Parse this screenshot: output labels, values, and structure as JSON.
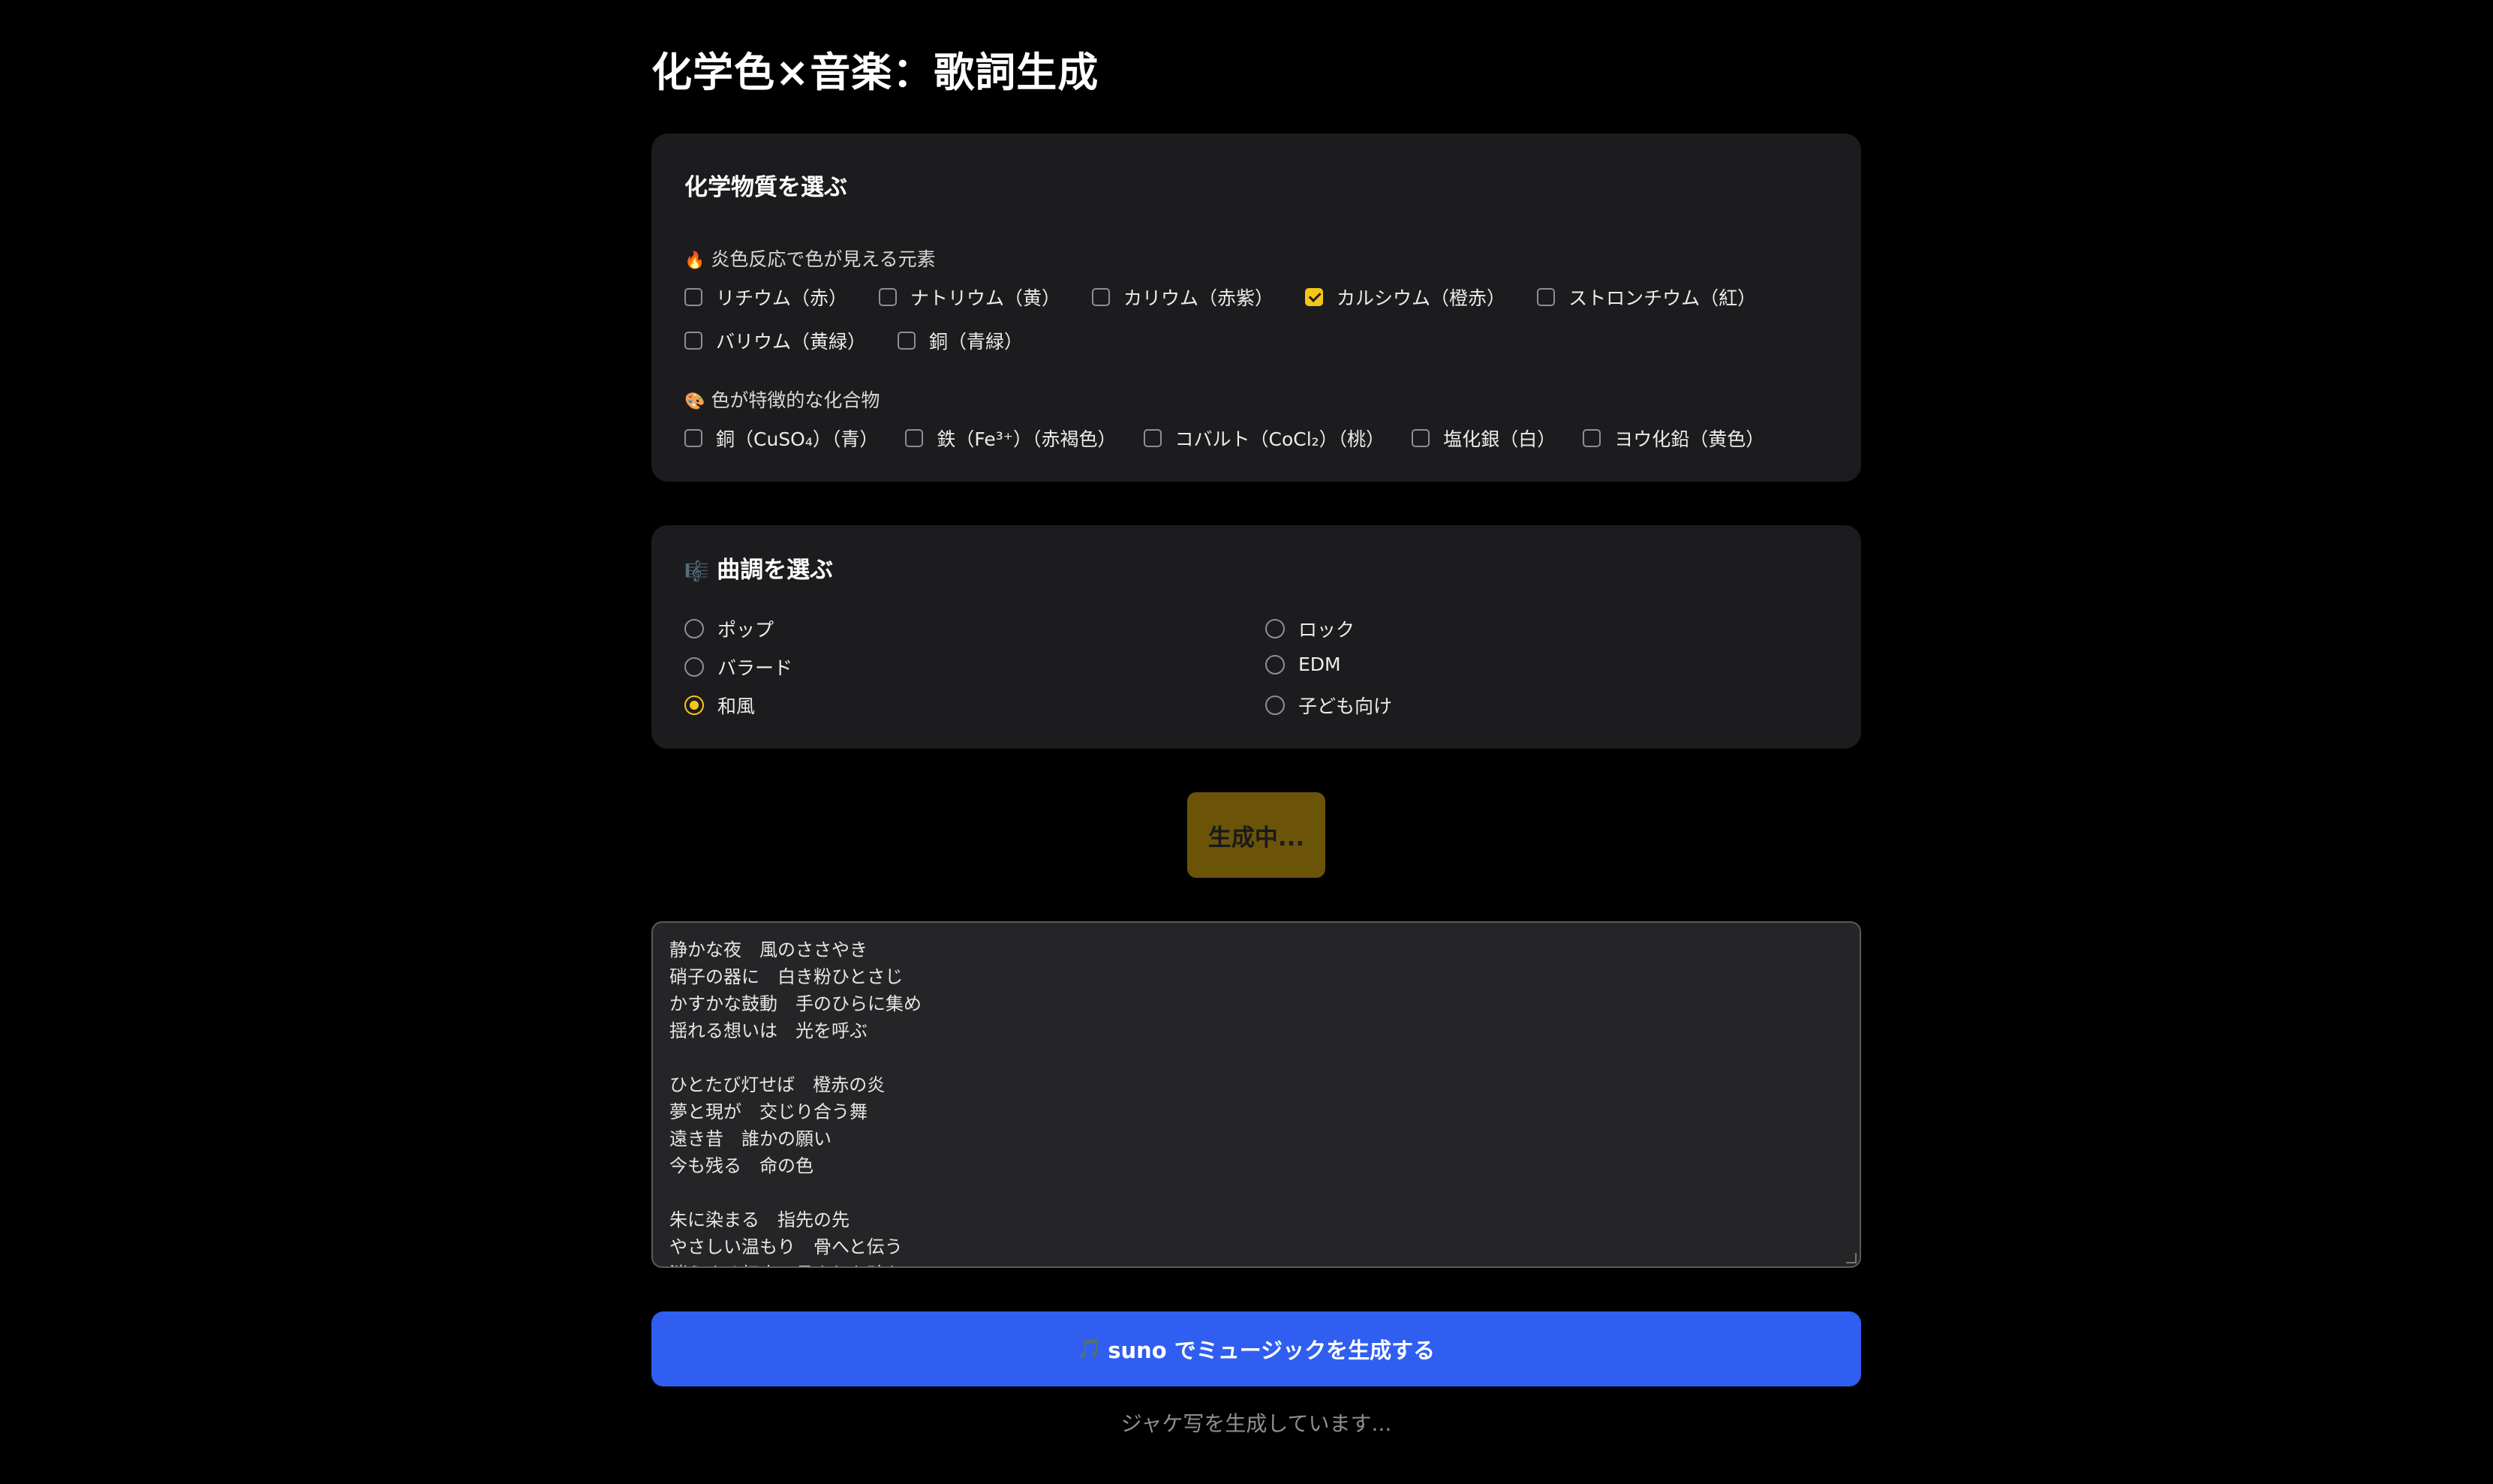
{
  "page": {
    "title": "化学色×音楽：歌詞生成"
  },
  "chemicals": {
    "heading": "化学物質を選ぶ",
    "flame": {
      "icon": "fire-icon",
      "icon_glyph": "🔥",
      "label": "炎色反応で色が見える元素",
      "items": [
        {
          "label": "リチウム（赤）",
          "checked": false
        },
        {
          "label": "ナトリウム（黄）",
          "checked": false
        },
        {
          "label": "カリウム（赤紫）",
          "checked": false
        },
        {
          "label": "カルシウム（橙赤）",
          "checked": true
        },
        {
          "label": "ストロンチウム（紅）",
          "checked": false
        },
        {
          "label": "バリウム（黄緑）",
          "checked": false
        },
        {
          "label": "銅（青緑）",
          "checked": false
        }
      ]
    },
    "compounds": {
      "icon": "palette-icon",
      "icon_glyph": "🎨",
      "label": "色が特徴的な化合物",
      "items": [
        {
          "label": "銅（CuSO₄）（青）",
          "checked": false
        },
        {
          "label": "鉄（Fe³⁺）（赤褐色）",
          "checked": false
        },
        {
          "label": "コバルト（CoCl₂）（桃）",
          "checked": false
        },
        {
          "label": "塩化銀（白）",
          "checked": false
        },
        {
          "label": "ヨウ化鉛（黄色）",
          "checked": false
        }
      ]
    }
  },
  "mood": {
    "icon": "music-score-icon",
    "icon_glyph": "🎼",
    "heading": "曲調を選ぶ",
    "options": [
      {
        "label": "ポップ",
        "checked": false
      },
      {
        "label": "ロック",
        "checked": false
      },
      {
        "label": "バラード",
        "checked": false
      },
      {
        "label": "EDM",
        "checked": false
      },
      {
        "label": "和風",
        "checked": true
      },
      {
        "label": "子ども向け",
        "checked": false
      }
    ]
  },
  "generate_button": {
    "label": "生成中..."
  },
  "lyrics": {
    "lines": [
      "静かな夜　風のささやき",
      "硝子の器に　白き粉ひとさじ",
      "かすかな鼓動　手のひらに集め",
      "揺れる想いは　光を呼ぶ",
      "",
      "ひとたび灯せば　橙赤の炎",
      "夢と現が　交じり合う舞",
      "遠き昔　誰かの願い",
      "今も残る　命の色",
      "",
      "朱に染まる　指先の先",
      "やさしい温もり　骨へと伝う",
      "消えゆく灯火　月よりも確か"
    ]
  },
  "suno_button": {
    "icon": "music-note-icon",
    "icon_glyph": "🎵",
    "label": "suno でミュージックを生成する"
  },
  "status": {
    "text": "ジャケ写を生成しています..."
  },
  "colors": {
    "background": "#000000",
    "card": "#1c1c1e",
    "accent_yellow": "#f5c518",
    "generating_button": "#6b5308",
    "suno_blue": "#2f5ef0"
  }
}
